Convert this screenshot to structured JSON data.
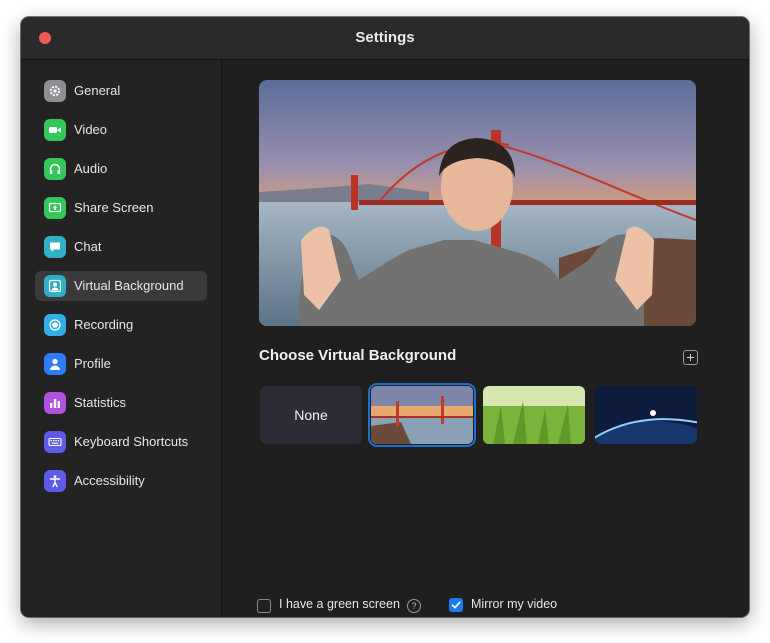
{
  "window": {
    "title": "Settings"
  },
  "sidebar": {
    "items": [
      {
        "label": "General",
        "icon": "gear-icon",
        "color": "#8e8e93"
      },
      {
        "label": "Video",
        "icon": "video-camera-icon",
        "color": "#34c759"
      },
      {
        "label": "Audio",
        "icon": "headphones-icon",
        "color": "#34c759"
      },
      {
        "label": "Share Screen",
        "icon": "share-screen-icon",
        "color": "#34c759"
      },
      {
        "label": "Chat",
        "icon": "chat-bubble-icon",
        "color": "#30b0c7"
      },
      {
        "label": "Virtual Background",
        "icon": "person-portrait-icon",
        "color": "#30b0c7",
        "active": true
      },
      {
        "label": "Recording",
        "icon": "record-icon",
        "color": "#32ade6"
      },
      {
        "label": "Profile",
        "icon": "person-icon",
        "color": "#2f7cf6"
      },
      {
        "label": "Statistics",
        "icon": "bar-chart-icon",
        "color": "#af52de"
      },
      {
        "label": "Keyboard Shortcuts",
        "icon": "keyboard-icon",
        "color": "#5e5ce6"
      },
      {
        "label": "Accessibility",
        "icon": "accessibility-icon",
        "color": "#5e5ce6"
      }
    ]
  },
  "main": {
    "section_title": "Choose Virtual Background",
    "backgrounds": [
      {
        "label": "None",
        "kind": "none"
      },
      {
        "label": "",
        "kind": "golden-gate-bridge",
        "selected": true
      },
      {
        "label": "",
        "kind": "grass"
      },
      {
        "label": "",
        "kind": "earth-from-space"
      }
    ],
    "green_screen": {
      "label": "I have a green screen",
      "checked": false
    },
    "mirror": {
      "label": "Mirror my video",
      "checked": true
    }
  },
  "colors": {
    "accent": "#1a7cf2",
    "close_button": "#ee5b54",
    "window_bg": "#1f1f1f",
    "sidebar_active": "#3a3a3d"
  }
}
